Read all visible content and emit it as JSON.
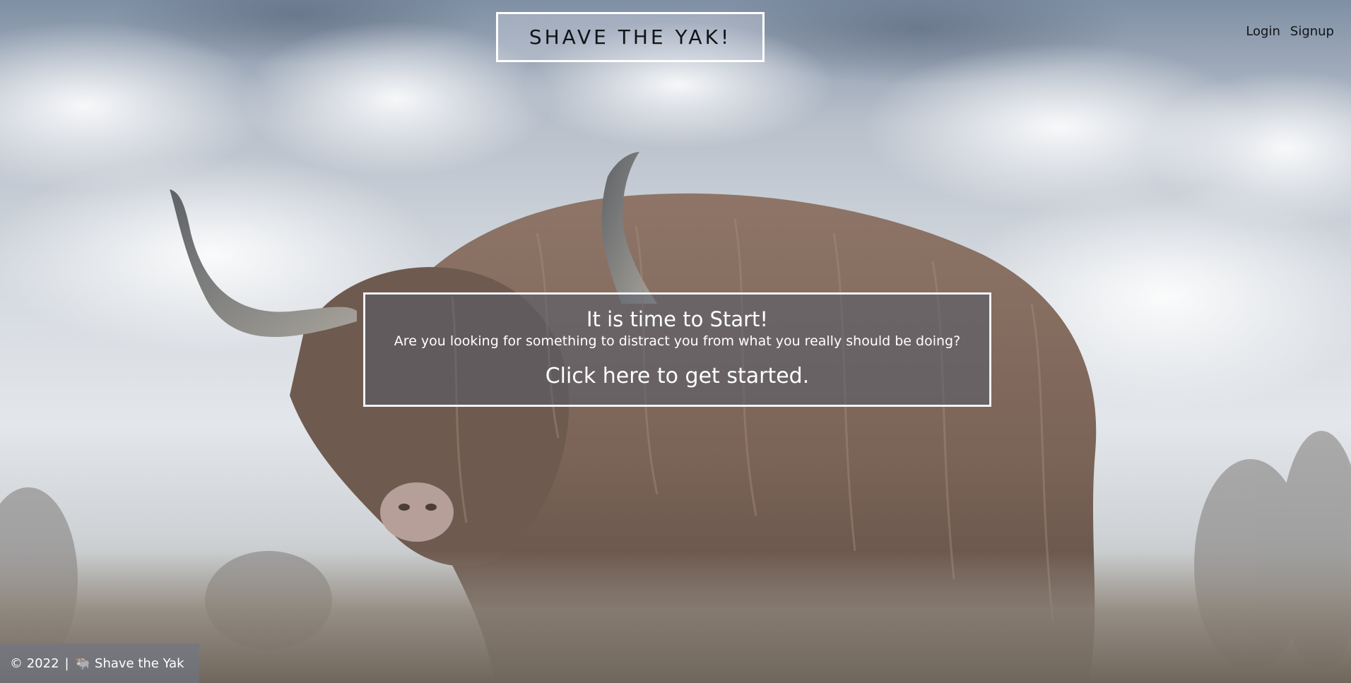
{
  "header": {
    "brand_title": "SHAVE THE YAK!",
    "nav": {
      "login_label": "Login",
      "signup_label": "Signup"
    }
  },
  "hero": {
    "heading": "It is time to Start!",
    "subheading": "Are you looking for something to distract you from what you really should be doing?",
    "cta_label": "Click here to get started."
  },
  "footer": {
    "copyright": "© 2022",
    "separator": "|",
    "yak_icon": "🐃",
    "site_name": "Shave the Yak"
  },
  "background": {
    "subject": "yak-photo",
    "sky_color": "#aeb8c6",
    "coat_color": "#8a7466"
  }
}
